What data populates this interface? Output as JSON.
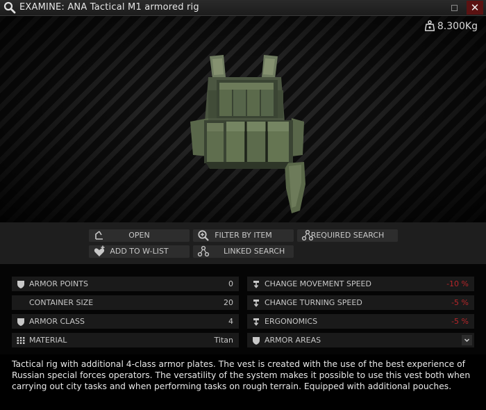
{
  "window": {
    "title": "EXAMINE: ANA Tactical M1 armored rig",
    "weight": "8.300Kg"
  },
  "actions": {
    "open": "OPEN",
    "filter_by_item": "FILTER BY ITEM",
    "required_search": "REQUIRED SEARCH",
    "add_to_wishlist": "ADD TO W-LIST",
    "linked_search": "LINKED SEARCH"
  },
  "stats": {
    "armor_points": {
      "label": "ARMOR POINTS",
      "value": "0"
    },
    "container_size": {
      "label": "CONTAINER SIZE",
      "value": "20"
    },
    "armor_class": {
      "label": "ARMOR CLASS",
      "value": "4"
    },
    "material": {
      "label": "MATERIAL",
      "value": "Titan"
    },
    "movement_speed": {
      "label": "CHANGE MOVEMENT SPEED",
      "value": "-10 %"
    },
    "turning_speed": {
      "label": "CHANGE TURNING SPEED",
      "value": "-5 %"
    },
    "ergonomics": {
      "label": "ERGONOMICS",
      "value": "-5 %"
    },
    "armor_areas": {
      "label": "ARMOR AREAS"
    }
  },
  "colors": {
    "negative_value": "#b8262a",
    "close_button": "#5a1212",
    "panel": "#1a1a1a"
  },
  "description": "Tactical rig with additional 4-class armor plates. The vest is created with the use of the best experience of Russian special forces operators. The versatility of the system makes it possible to use this vest both when carrying out city tasks and when performing tasks on rough terrain. Equipped with additional pouches."
}
